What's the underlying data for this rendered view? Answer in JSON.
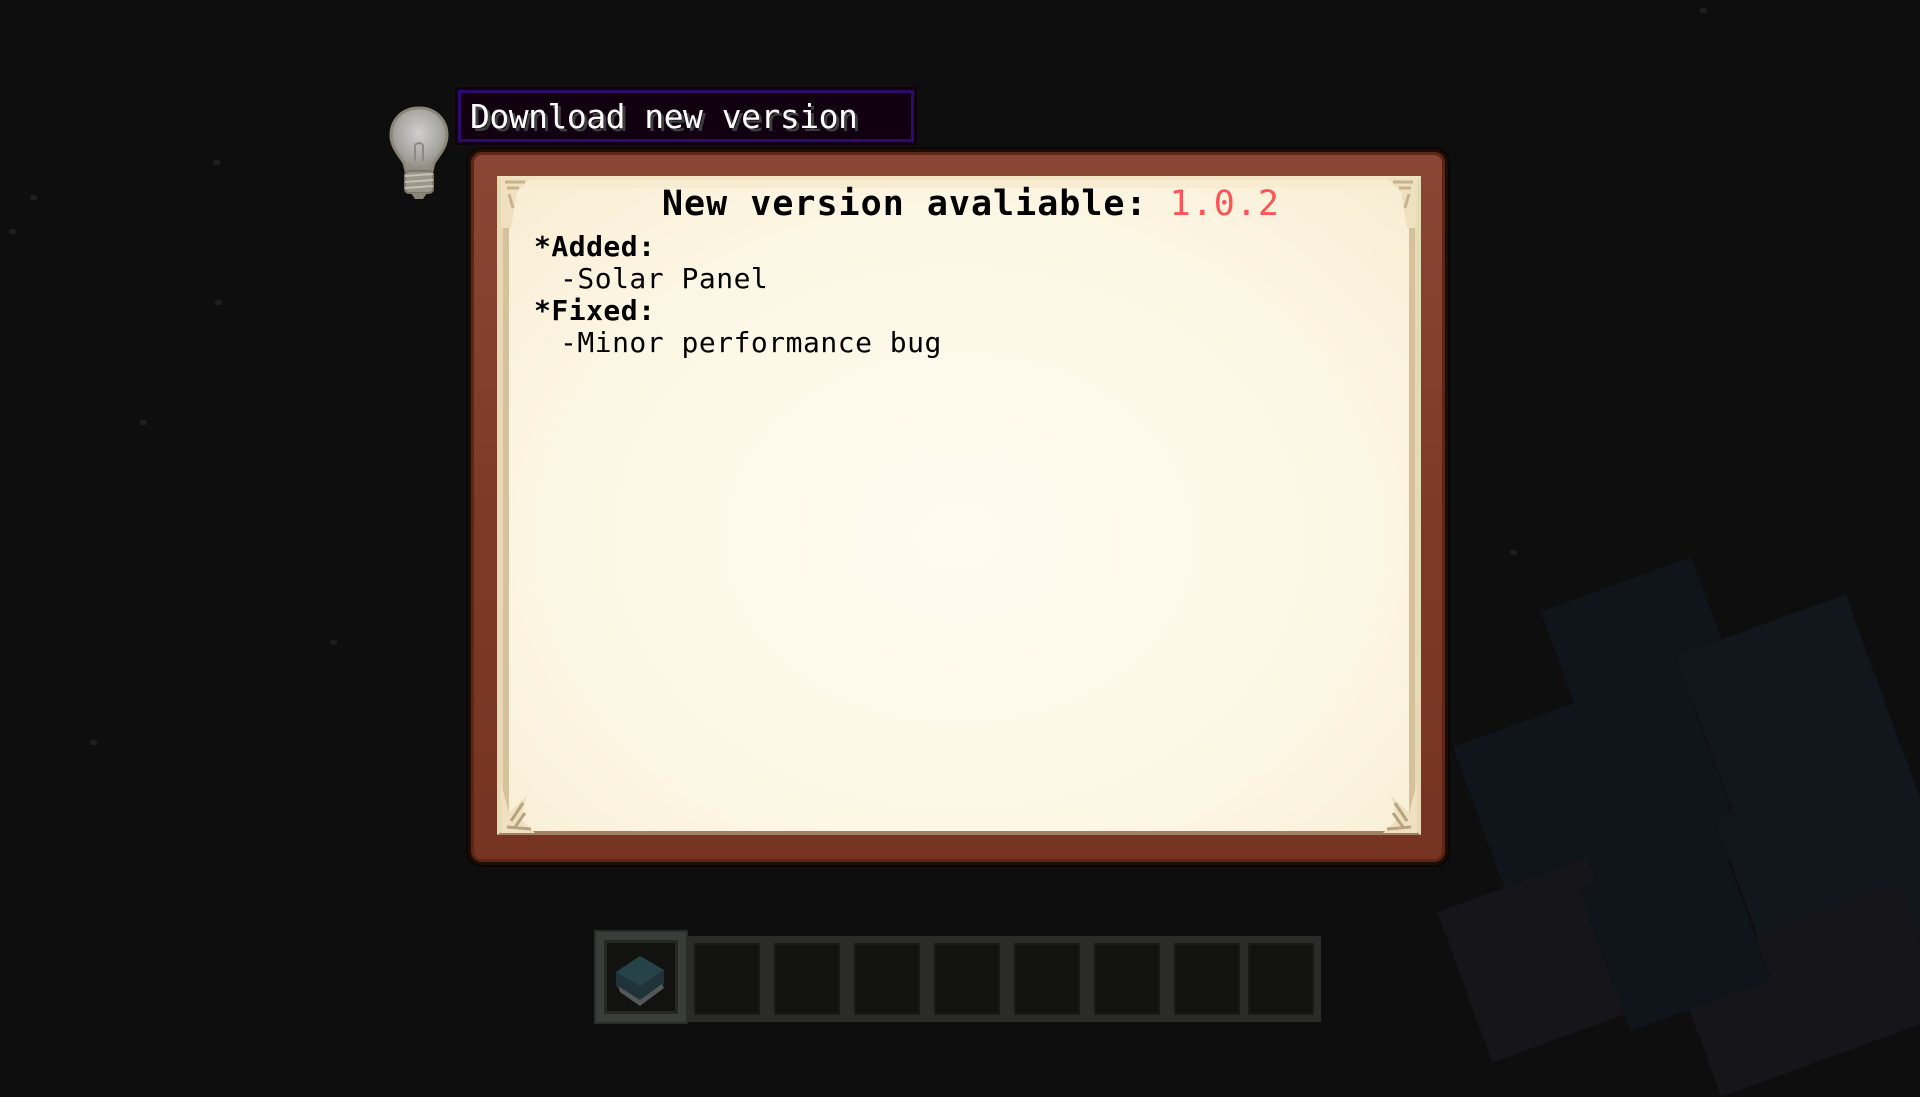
{
  "tooltip": {
    "text": "Download new version",
    "icon": "lightbulb-icon"
  },
  "dialog": {
    "title_prefix": "New version avaliable: ",
    "version": "1.0.2",
    "version_color": "#ff5555",
    "changelog": [
      {
        "type": "head",
        "text": "*Added:"
      },
      {
        "type": "item",
        "text": "-Solar Panel"
      },
      {
        "type": "head",
        "text": "*Fixed:"
      },
      {
        "type": "item",
        "text": "-Minor performance bug"
      }
    ]
  },
  "hotbar": {
    "selected_slot": 1,
    "slots": [
      {
        "item": "manual-book"
      },
      {
        "item": ""
      },
      {
        "item": ""
      },
      {
        "item": ""
      },
      {
        "item": ""
      },
      {
        "item": ""
      },
      {
        "item": ""
      },
      {
        "item": ""
      },
      {
        "item": ""
      }
    ]
  }
}
